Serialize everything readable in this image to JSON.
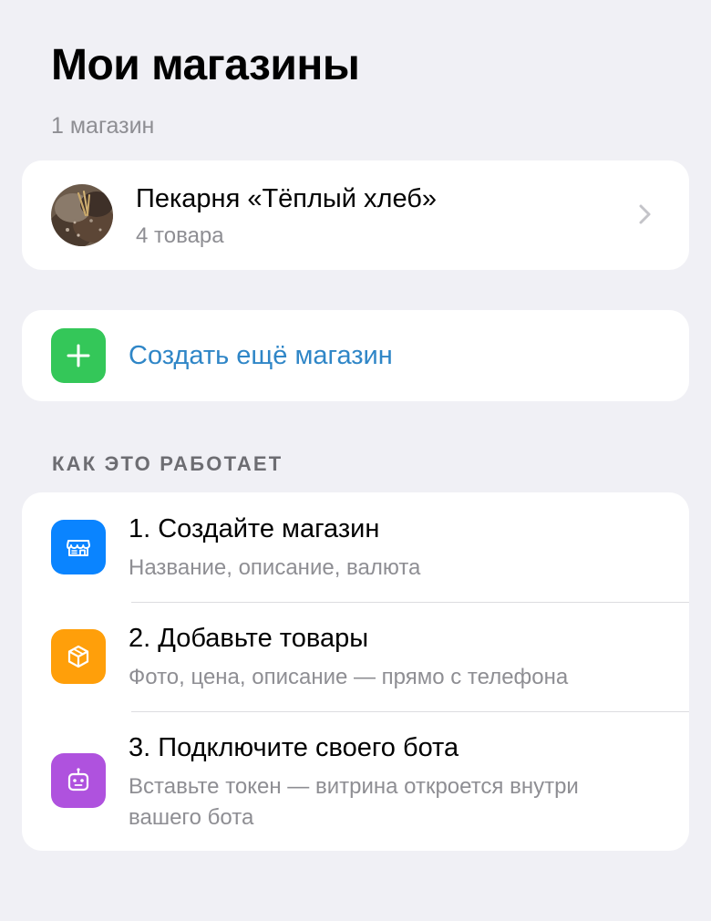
{
  "header": {
    "title": "Мои магазины",
    "subtitle": "1 магазин"
  },
  "shops": [
    {
      "name": "Пекарня «Тёплый хлеб»",
      "count": "4 товара"
    }
  ],
  "create": {
    "label": "Создать ещё магазин",
    "icon": "plus-icon",
    "color": "#34c759"
  },
  "how_it_works": {
    "heading": "КАК ЭТО РАБОТАЕТ",
    "steps": [
      {
        "title": "1. Создайте магазин",
        "description": "Название, описание, валюта",
        "icon": "storefront-icon",
        "color": "#0a84ff"
      },
      {
        "title": "2. Добавьте товары",
        "description": "Фото, цена, описание — прямо с телефона",
        "icon": "box-icon",
        "color": "#ff9f0a"
      },
      {
        "title": "3. Подключите своего бота",
        "description": "Вставьте токен — витрина откроется внутри вашего бота",
        "icon": "robot-icon",
        "color": "#af52de"
      }
    ]
  },
  "colors": {
    "background": "#f0f0f5",
    "link": "#2f86c7",
    "secondary_text": "#8e8e93"
  }
}
